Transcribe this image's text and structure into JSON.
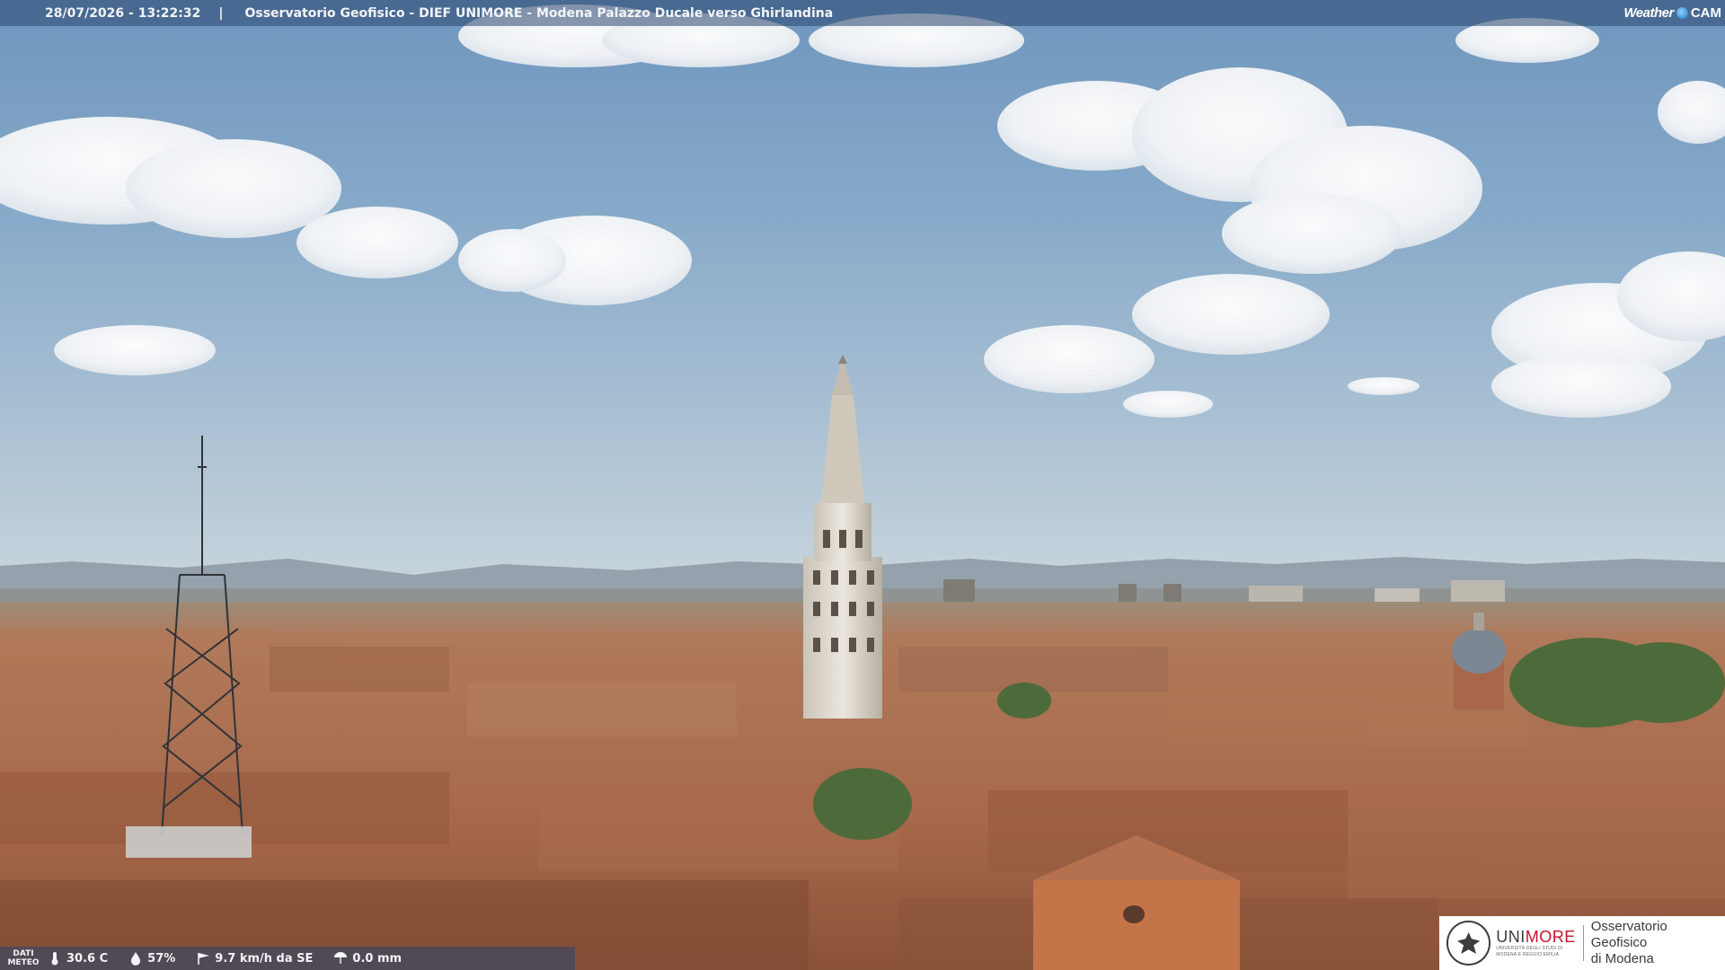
{
  "topbar": {
    "timestamp": "28/07/2026 - 13:22:32",
    "separator": "|",
    "title": "Osservatorio Geofisico - DIEF UNIMORE - Modena Palazzo Ducale verso Ghirlandina",
    "brand_weather": "Weather",
    "brand_cam": "CAM"
  },
  "meteo": {
    "label_line1": "DATI",
    "label_line2": "METEO",
    "temperature": "30.6 C",
    "humidity": "57%",
    "wind": "9.7 km/h da SE",
    "rain": "0.0 mm",
    "icons": [
      "thermometer-icon",
      "humidity-icon",
      "wind-icon",
      "rain-icon"
    ]
  },
  "logo": {
    "uni_prefix": "UNI",
    "uni_suffix": "MORE",
    "uni_small_1": "UNIVERSITÀ DEGLI STUDI DI",
    "uni_small_2": "MODENA E REGGIO EMILIA",
    "obs_line1": "Osservatorio Geofisico",
    "obs_line2": "di Modena",
    "accent": "#c8102e"
  },
  "colors": {
    "overlay_bar": "#28466e",
    "roof": "#a0674a",
    "sky": "#86a9c9"
  }
}
